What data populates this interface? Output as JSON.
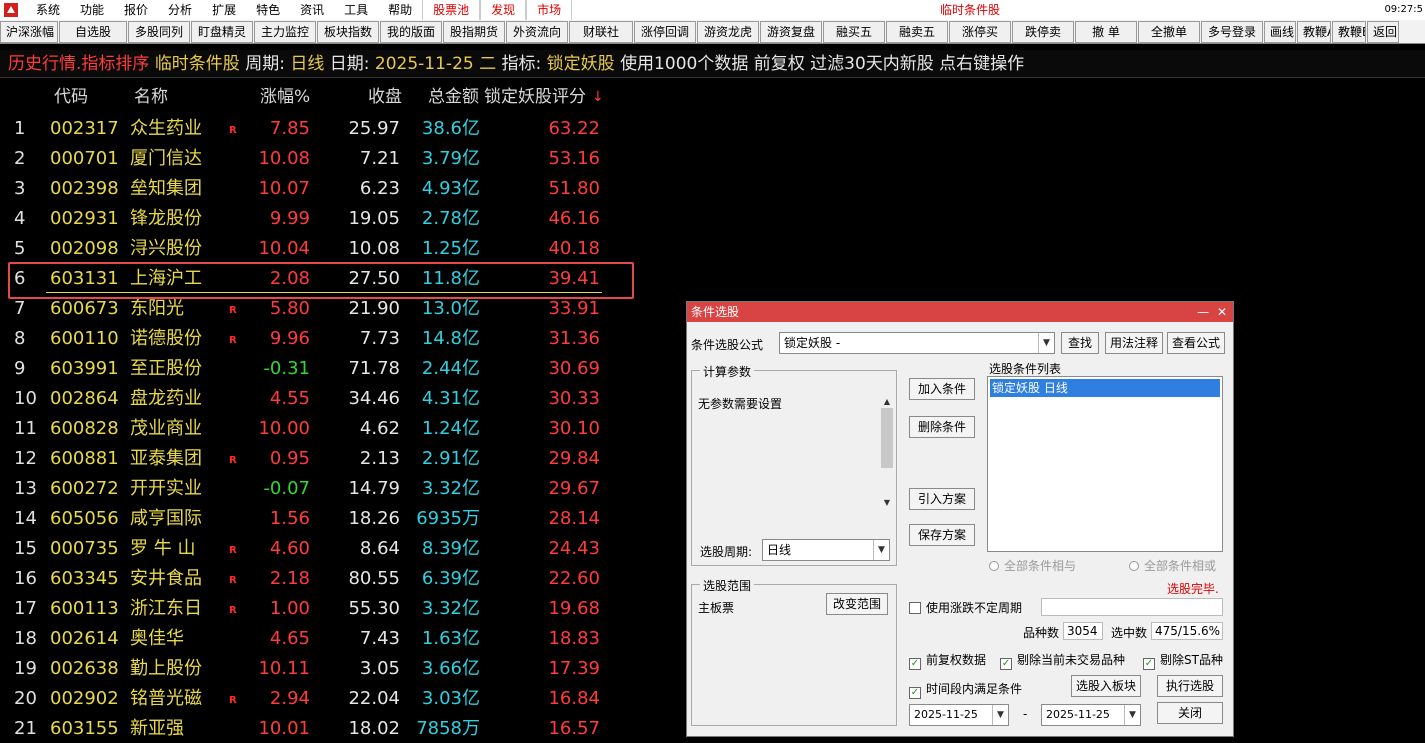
{
  "menubar": {
    "items": [
      "系统",
      "功能",
      "报价",
      "分析",
      "扩展",
      "特色",
      "资讯",
      "工具",
      "帮助"
    ],
    "highlight": [
      "股票池",
      "发现",
      "市场"
    ],
    "title": "临时条件股",
    "clock": "09:27:5"
  },
  "toolbar": {
    "buttons": [
      "沪深涨幅",
      "自选股",
      "多股同列",
      "盯盘精灵",
      "主力监控",
      "板块指数",
      "我的版面",
      "股指期货",
      "外资流向",
      "财联社",
      "涨停回调",
      "游资龙虎",
      "游资复盘",
      "融买五",
      "融卖五",
      "涨停买",
      "跌停卖",
      "撤 单",
      "全撤单",
      "多号登录",
      "画线",
      "教鞭A",
      "教鞭B",
      "返回"
    ]
  },
  "info": {
    "part1": "历史行情.指标排序",
    "part2": "临时条件股",
    "part3": "周期:",
    "part4": "日线",
    "part5": "日期:",
    "part6": "2025-11-25 二",
    "part7": "指标:",
    "part8": "锁定妖股",
    "part9": "使用1000个数据 前复权 过滤30天内新股 点右键操作"
  },
  "columns": {
    "code": "代码",
    "name": "名称",
    "chg": "涨幅%",
    "close": "收盘",
    "amount": "总金额",
    "score": "锁定妖股评分",
    "sort_icon": "↓"
  },
  "rows": [
    {
      "idx": "1",
      "code": "002317",
      "name": "众生药业",
      "r": "R",
      "chg": "7.85",
      "dir": "up",
      "close": "25.97",
      "amount": "38.6亿",
      "score": "63.22"
    },
    {
      "idx": "2",
      "code": "000701",
      "name": "厦门信达",
      "r": "",
      "chg": "10.08",
      "dir": "up",
      "close": "7.21",
      "amount": "3.79亿",
      "score": "53.16"
    },
    {
      "idx": "3",
      "code": "002398",
      "name": "垒知集团",
      "r": "",
      "chg": "10.07",
      "dir": "up",
      "close": "6.23",
      "amount": "4.93亿",
      "score": "51.80"
    },
    {
      "idx": "4",
      "code": "002931",
      "name": "锋龙股份",
      "r": "",
      "chg": "9.99",
      "dir": "up",
      "close": "19.05",
      "amount": "2.78亿",
      "score": "46.16"
    },
    {
      "idx": "5",
      "code": "002098",
      "name": "浔兴股份",
      "r": "",
      "chg": "10.04",
      "dir": "up",
      "close": "10.08",
      "amount": "1.25亿",
      "score": "40.18"
    },
    {
      "idx": "6",
      "code": "603131",
      "name": "上海沪工",
      "r": "",
      "chg": "2.08",
      "dir": "up",
      "close": "27.50",
      "amount": "11.8亿",
      "score": "39.41"
    },
    {
      "idx": "7",
      "code": "600673",
      "name": "东阳光",
      "r": "R",
      "chg": "5.80",
      "dir": "up",
      "close": "21.90",
      "amount": "13.0亿",
      "score": "33.91"
    },
    {
      "idx": "8",
      "code": "600110",
      "name": "诺德股份",
      "r": "R",
      "chg": "9.96",
      "dir": "up",
      "close": "7.73",
      "amount": "14.8亿",
      "score": "31.36"
    },
    {
      "idx": "9",
      "code": "603991",
      "name": "至正股份",
      "r": "",
      "chg": "-0.31",
      "dir": "down",
      "close": "71.78",
      "amount": "2.44亿",
      "score": "30.69"
    },
    {
      "idx": "10",
      "code": "002864",
      "name": "盘龙药业",
      "r": "",
      "chg": "4.55",
      "dir": "up",
      "close": "34.46",
      "amount": "4.31亿",
      "score": "30.33"
    },
    {
      "idx": "11",
      "code": "600828",
      "name": "茂业商业",
      "r": "",
      "chg": "10.00",
      "dir": "up",
      "close": "4.62",
      "amount": "1.24亿",
      "score": "30.10"
    },
    {
      "idx": "12",
      "code": "600881",
      "name": "亚泰集团",
      "r": "R",
      "chg": "0.95",
      "dir": "up",
      "close": "2.13",
      "amount": "2.91亿",
      "score": "29.84"
    },
    {
      "idx": "13",
      "code": "600272",
      "name": "开开实业",
      "r": "",
      "chg": "-0.07",
      "dir": "down",
      "close": "14.79",
      "amount": "3.32亿",
      "score": "29.67"
    },
    {
      "idx": "14",
      "code": "605056",
      "name": "咸亨国际",
      "r": "",
      "chg": "1.56",
      "dir": "up",
      "close": "18.26",
      "amount": "6935万",
      "score": "28.14"
    },
    {
      "idx": "15",
      "code": "000735",
      "name": "罗 牛 山",
      "r": "R",
      "chg": "4.60",
      "dir": "up",
      "close": "8.64",
      "amount": "8.39亿",
      "score": "24.43"
    },
    {
      "idx": "16",
      "code": "603345",
      "name": "安井食品",
      "r": "R",
      "chg": "2.18",
      "dir": "up",
      "close": "80.55",
      "amount": "6.39亿",
      "score": "22.60"
    },
    {
      "idx": "17",
      "code": "600113",
      "name": "浙江东日",
      "r": "R",
      "chg": "1.00",
      "dir": "up",
      "close": "55.30",
      "amount": "3.32亿",
      "score": "19.68"
    },
    {
      "idx": "18",
      "code": "002614",
      "name": "奥佳华",
      "r": "",
      "chg": "4.65",
      "dir": "up",
      "close": "7.43",
      "amount": "1.63亿",
      "score": "18.83"
    },
    {
      "idx": "19",
      "code": "002638",
      "name": "勤上股份",
      "r": "",
      "chg": "10.11",
      "dir": "up",
      "close": "3.05",
      "amount": "3.66亿",
      "score": "17.39"
    },
    {
      "idx": "20",
      "code": "002902",
      "name": "铭普光磁",
      "r": "R",
      "chg": "2.94",
      "dir": "up",
      "close": "22.04",
      "amount": "3.03亿",
      "score": "16.84"
    },
    {
      "idx": "21",
      "code": "603155",
      "name": "新亚强",
      "r": "",
      "chg": "10.01",
      "dir": "up",
      "close": "18.02",
      "amount": "7858万",
      "score": "16.57"
    }
  ],
  "dialog": {
    "title": "条件选股",
    "formula_label": "条件选股公式",
    "formula_value": "锁定妖股  -",
    "find": "查找",
    "usage": "用法注释",
    "view_formula": "查看公式",
    "params_group": "计算参数",
    "params_text": "无参数需要设置",
    "add_cond": "加入条件",
    "del_cond": "删除条件",
    "import_plan": "引入方案",
    "save_plan": "保存方案",
    "cond_list_label": "选股条件列表",
    "cond_item": "锁定妖股  日线",
    "period_label": "选股周期:",
    "period_value": "日线",
    "and_label": "全部条件相与",
    "or_label": "全部条件相或",
    "done": "选股完毕.",
    "scope_group": "选股范围",
    "scope_text": "主板票",
    "change_scope": "改变范围",
    "use_period": "使用涨跌不定周期",
    "count_label": "品种数",
    "count_value": "3054",
    "hit_label": "选中数",
    "hit_value": "475/15.6%",
    "adj": "前复权数据",
    "exclude_untraded": "剔除当前未交易品种",
    "exclude_st": "剔除ST品种",
    "in_range": "时间段内满足条件",
    "to_block": "选股入板块",
    "run": "执行选股",
    "date_from": "2025-11-25",
    "dash": "-",
    "date_to": "2025-11-25",
    "close": "关闭",
    "min_glyph": "—",
    "close_glyph": "✕"
  },
  "colors": {
    "up": "#ff3b3b",
    "down": "#33d633",
    "amount": "#2fd0e0",
    "code": "#e8d94a",
    "accent": "#d84343"
  }
}
